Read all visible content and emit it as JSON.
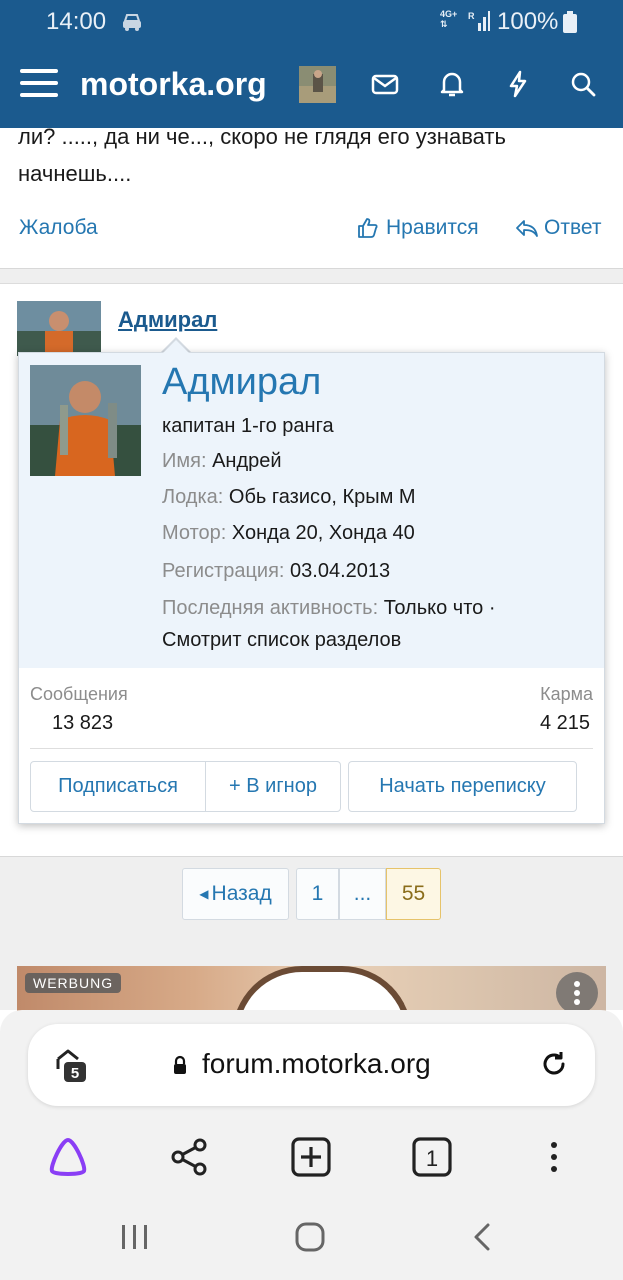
{
  "status_bar": {
    "time": "14:00",
    "network": "4G+",
    "roaming": "R",
    "battery": "100%"
  },
  "header": {
    "logo": "motorka.org",
    "icons": [
      "menu-icon",
      "avatar",
      "mail-icon",
      "bell-icon",
      "bolt-icon",
      "search-icon"
    ]
  },
  "prev_post": {
    "text": "ли? ....., да ни че..., скоро не глядя его узнавать начнешь....",
    "complain": "Жалоба",
    "like": "Нравится",
    "reply": "Ответ"
  },
  "post": {
    "username": "Адмирал"
  },
  "profile_popup": {
    "name": "Адмирал",
    "rank": "капитан 1-го ранга",
    "fields": [
      {
        "label": "Имя:",
        "value": "Андрей"
      },
      {
        "label": "Лодка:",
        "value": "Обь газисо, Крым М"
      },
      {
        "label": "Мотор:",
        "value": "Хонда 20, Хонда 40"
      },
      {
        "label": "Регистрация:",
        "value": "03.04.2013"
      }
    ],
    "activity_label": "Последняя активность:",
    "activity_value": "Только что ·",
    "activity_detail": "Смотрит список разделов",
    "messages_label": "Сообщения",
    "messages_value": "13 823",
    "karma_label": "Карма",
    "karma_value": "4 215",
    "buttons": {
      "subscribe": "Подписаться",
      "ignore": "+ В игнор",
      "message": "Начать переписку"
    }
  },
  "pagination": {
    "back": "Назад",
    "pages": [
      "1",
      "...",
      "55"
    ],
    "current": "55"
  },
  "ad": {
    "badge": "WERBUNG"
  },
  "browser": {
    "url": "forum.motorka.org",
    "tab_count": "5",
    "tabs_open": "1"
  },
  "colors": {
    "brand": "#1b5a8e",
    "link": "#2577b1",
    "popup_bg": "#edf4fb",
    "current_page": "#fdf7e4"
  }
}
